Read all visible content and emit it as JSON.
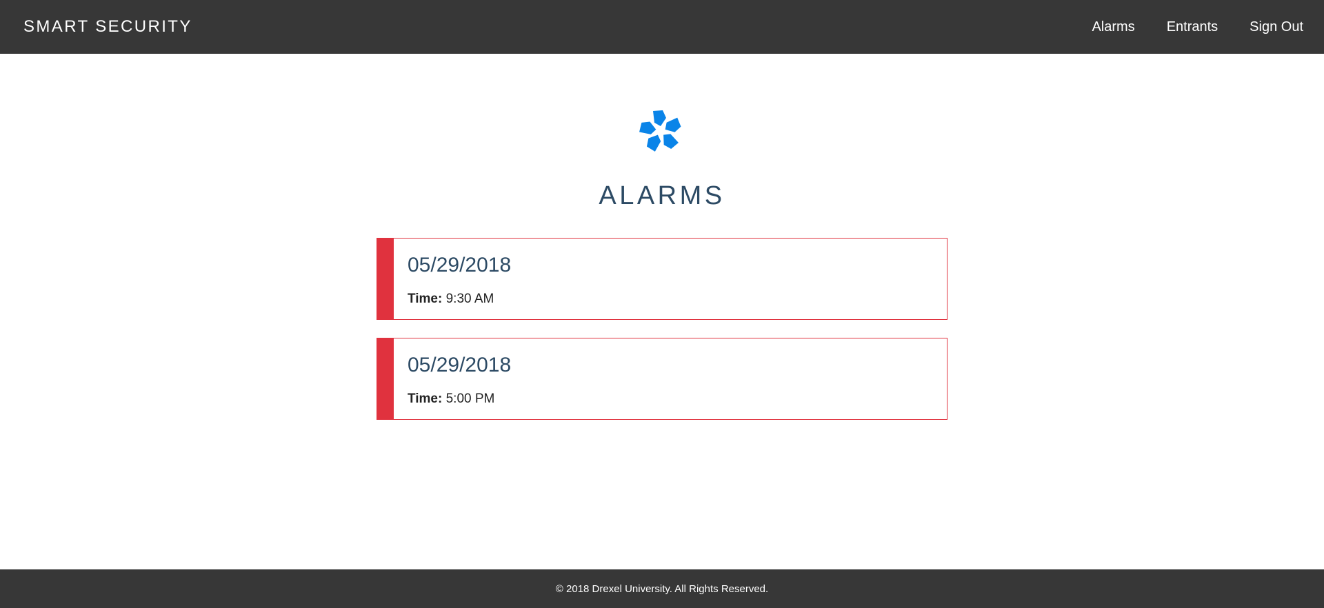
{
  "navbar": {
    "brand": "SMART SECURITY",
    "links": [
      {
        "label": "Alarms"
      },
      {
        "label": "Entrants"
      },
      {
        "label": "Sign Out"
      }
    ]
  },
  "main": {
    "logo_icon": "flower-logo-icon",
    "logo_color": "#0a84e8",
    "title": "ALARMS",
    "alarms": [
      {
        "date": "05/29/2018",
        "time_label": "Time:",
        "time_value": "9:30 AM"
      },
      {
        "date": "05/29/2018",
        "time_label": "Time:",
        "time_value": "5:00 PM"
      }
    ]
  },
  "footer": {
    "text": "© 2018 Drexel University. All Rights Reserved."
  },
  "colors": {
    "navbar_bg": "#373737",
    "alarm_accent": "#e0323e",
    "title_color": "#2c4a64"
  }
}
